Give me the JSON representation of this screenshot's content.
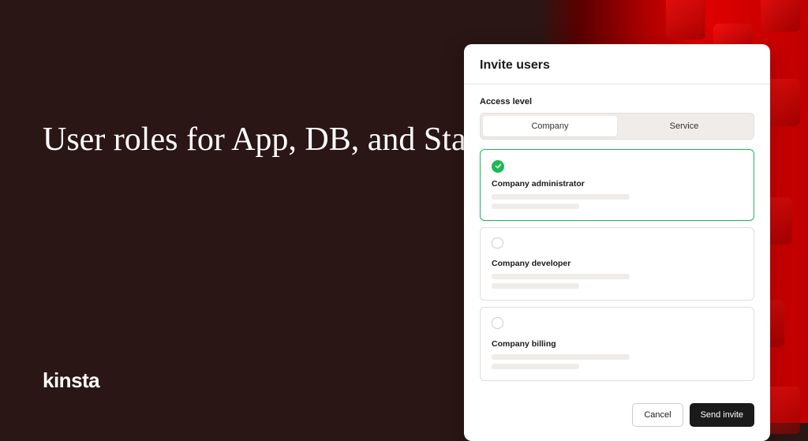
{
  "headline": "User roles for App, DB, and Static Site Hosting",
  "brand": "kinsta",
  "modal": {
    "title": "Invite users",
    "section_label": "Access level",
    "tabs": {
      "company": "Company",
      "service": "Service"
    },
    "roles": [
      {
        "label": "Company administrator",
        "selected": true
      },
      {
        "label": "Company developer",
        "selected": false
      },
      {
        "label": "Company billing",
        "selected": false
      }
    ],
    "buttons": {
      "cancel": "Cancel",
      "submit": "Send invite"
    }
  }
}
